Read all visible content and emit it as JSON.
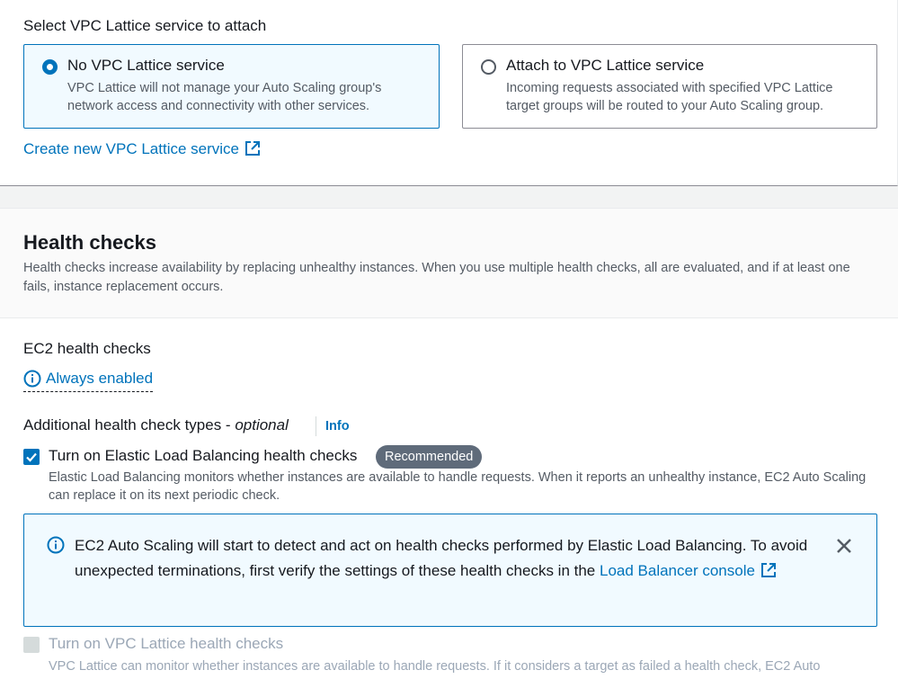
{
  "lattice": {
    "heading": "Select VPC Lattice service to attach",
    "options": [
      {
        "title": "No VPC Lattice service",
        "description": "VPC Lattice will not manage your Auto Scaling group's network access and connectivity with other services.",
        "selected": true
      },
      {
        "title": "Attach to VPC Lattice service",
        "description": "Incoming requests associated with specified VPC Lattice target groups will be routed to your Auto Scaling group.",
        "selected": false
      }
    ],
    "create_link": "Create new VPC Lattice service"
  },
  "health_checks": {
    "title": "Health checks",
    "description": "Health checks increase availability by replacing unhealthy instances. When you use multiple health checks, all are evaluated, and if at least one fails, instance replacement occurs.",
    "ec2_label": "EC2 health checks",
    "ec2_status": "Always enabled",
    "additional_label": "Additional health check types - ",
    "additional_optional": "optional",
    "info": "Info",
    "elb": {
      "label": "Turn on Elastic Load Balancing health checks",
      "checked": true,
      "badge": "Recommended",
      "description": "Elastic Load Balancing monitors whether instances are available to handle requests. When it reports an unhealthy instance, EC2 Auto Scaling can replace it on its next periodic check."
    },
    "alert": {
      "text": "EC2 Auto Scaling will start to detect and act on health checks performed by Elastic Load Balancing. To avoid unexpected terminations, first verify the settings of these health checks in the ",
      "link": "Load Balancer console"
    },
    "lattice_hc": {
      "label": "Turn on VPC Lattice health checks",
      "checked": false,
      "disabled": true,
      "description": "VPC Lattice can monitor whether instances are available to handle requests. If it considers a target as failed a health check, EC2 Auto"
    }
  },
  "colors": {
    "accent": "#0073bb",
    "text": "#16191f",
    "muted": "#545b64",
    "badge": "#5f6b7a"
  },
  "icons": {
    "external": "external-link-icon",
    "info": "info-circle-icon",
    "close": "close-icon",
    "check": "checkmark-icon"
  }
}
